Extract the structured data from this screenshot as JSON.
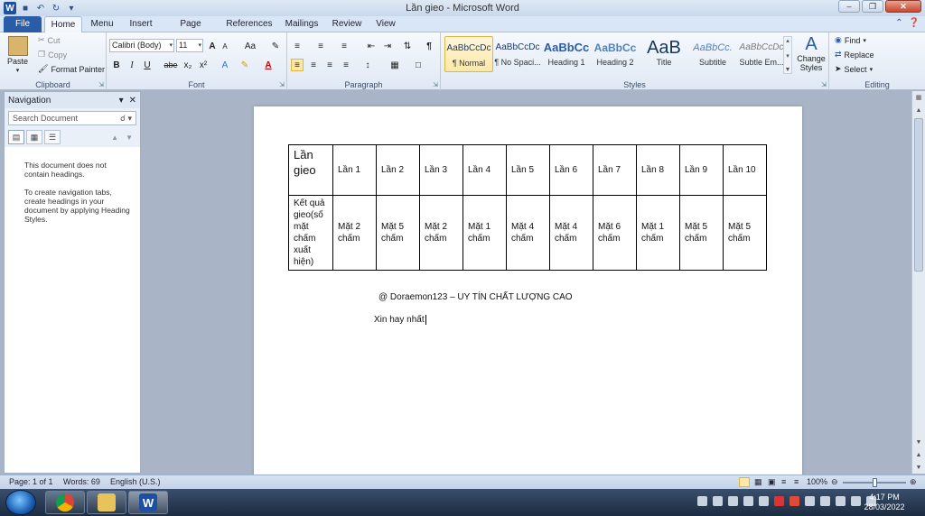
{
  "window": {
    "title": "Lần gieo - Microsoft Word"
  },
  "tabs": [
    "File",
    "Home",
    "Menu",
    "Insert",
    "Page Layout",
    "References",
    "Mailings",
    "Review",
    "View"
  ],
  "ribbon": {
    "clipboard": {
      "label": "Clipboard",
      "paste": "Paste",
      "cut": "Cut",
      "copy": "Copy",
      "format_painter": "Format Painter"
    },
    "font": {
      "label": "Font",
      "font_name": "Calibri (Body)",
      "font_size": "11",
      "bold": "B",
      "italic": "I",
      "underline": "U",
      "strike": "abe",
      "sub": "x₂",
      "sup": "x²",
      "grow": "A",
      "shrink": "A",
      "case": "Aa"
    },
    "paragraph": {
      "label": "Paragraph"
    },
    "styles": {
      "label": "Styles",
      "items": [
        {
          "sample": "AaBbCcDc",
          "name": "¶ Normal"
        },
        {
          "sample": "AaBbCcDc",
          "name": "¶ No Spaci..."
        },
        {
          "sample": "AaBbCc",
          "name": "Heading 1"
        },
        {
          "sample": "AaBbCc",
          "name": "Heading 2"
        },
        {
          "sample": "AaB",
          "name": "Title"
        },
        {
          "sample": "AaBbCc.",
          "name": "Subtitle"
        },
        {
          "sample": "AaBbCcDc",
          "name": "Subtle Em..."
        }
      ],
      "change_styles": "Change Styles"
    },
    "editing": {
      "label": "Editing",
      "find": "Find",
      "replace": "Replace",
      "select": "Select"
    }
  },
  "nav": {
    "title": "Navigation",
    "search_placeholder": "Search Document",
    "msg1": "This document does not contain headings.",
    "msg2": "To create navigation tabs, create headings in your document by applying Heading Styles."
  },
  "document": {
    "table": {
      "row1": [
        "Lần gieo",
        "Lần 1",
        "Lần 2",
        "Lần 3",
        "Lần 4",
        "Lần 5",
        "Lần 6",
        "Lần 7",
        "Lần 8",
        "Lần 9",
        "Lần 10"
      ],
      "row2": [
        "Kết quả gieo(số mặt chấm xuất hiện)",
        "Mặt 2 chấm",
        "Mặt 5 chấm",
        "Mặt 2 chấm",
        "Mặt 1 chấm",
        "Mặt 4 chấm",
        "Mặt 4 chấm",
        "Mặt 6 chấm",
        "Mặt 1 chấm",
        "Mặt 5 chấm",
        "Mặt 5 chấm"
      ]
    },
    "line1": "@ Doraemon123 – UY TÍN CHẤT LƯỢNG CAO",
    "line2": "Xin hay nhất"
  },
  "status": {
    "page": "Page: 1 of 1",
    "words": "Words: 69",
    "language": "English (U.S.)",
    "zoom": "100%",
    "zoom_level": 1.0
  },
  "taskbar": {
    "time": "4:17 PM",
    "date": "28/03/2022"
  }
}
